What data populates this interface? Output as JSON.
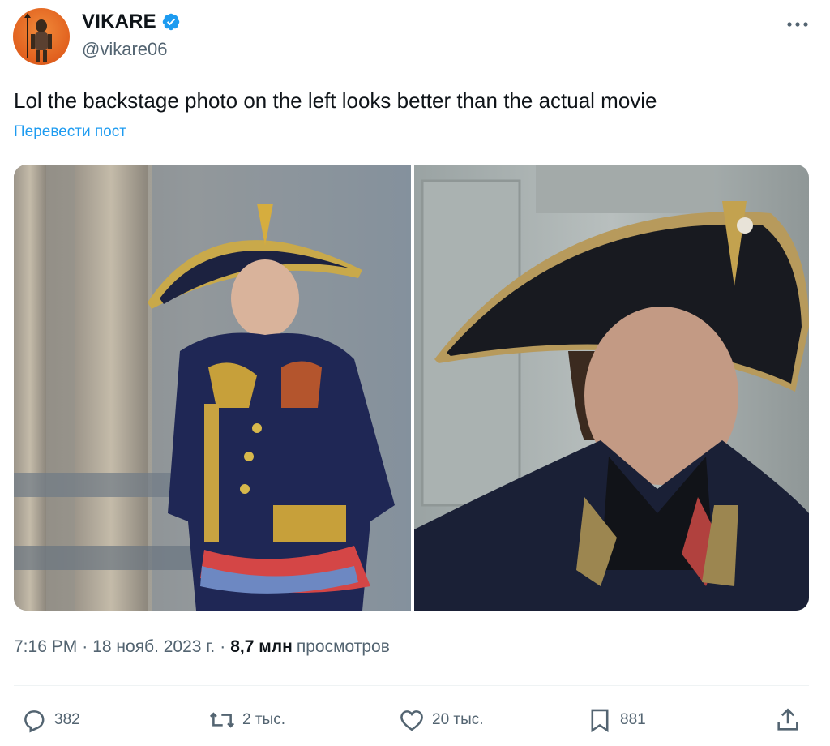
{
  "author": {
    "display_name": "VIKARE",
    "handle": "@vikare06"
  },
  "tweet": {
    "text": "Lol the backstage photo on the left looks better than the actual movie",
    "translate_label": "Перевести пост"
  },
  "meta": {
    "time": "7:16 PM",
    "separator": "·",
    "date": "18 нояб. 2023 г.",
    "views_count": "8,7 млн",
    "views_label": "просмотров"
  },
  "actions": {
    "replies": "382",
    "reposts": "2 тыс.",
    "likes": "20 тыс.",
    "bookmarks": "881"
  },
  "colors": {
    "accent": "#1d9bf0",
    "secondary_text": "#536471",
    "primary_text": "#0f1419"
  },
  "icons": {
    "verified": "verified-badge-icon",
    "more": "more-dots-icon",
    "reply": "reply-icon",
    "repost": "repost-icon",
    "like": "like-icon",
    "bookmark": "bookmark-icon",
    "share": "share-icon"
  }
}
